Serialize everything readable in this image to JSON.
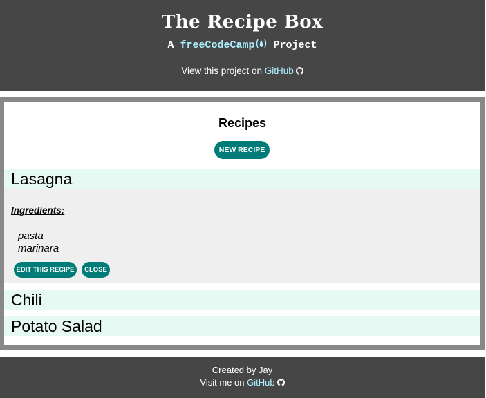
{
  "header": {
    "title": "The Recipe Box",
    "subtitle_prefix": "A ",
    "subtitle_link": "freeCodeCamp",
    "subtitle_suffix": " Project",
    "view_text": "View this project on ",
    "view_link": "GitHub",
    "link_color": "#aef0ff"
  },
  "main": {
    "heading": "Recipes",
    "new_recipe_label": "NEW RECIPE",
    "recipes": [
      {
        "name": "Lasagna",
        "expanded": true,
        "ingredients_label": "Ingredients:",
        "ingredients": [
          "pasta",
          "marinara"
        ],
        "edit_label": "EDIT THIS RECIPE",
        "close_label": "CLOSE"
      },
      {
        "name": "Chili",
        "expanded": false
      },
      {
        "name": "Potato Salad",
        "expanded": false
      }
    ],
    "accent_color": "#007c78"
  },
  "footer": {
    "created_by": "Created by Jay",
    "visit_text": "Visit me on ",
    "visit_link": "GitHub"
  }
}
